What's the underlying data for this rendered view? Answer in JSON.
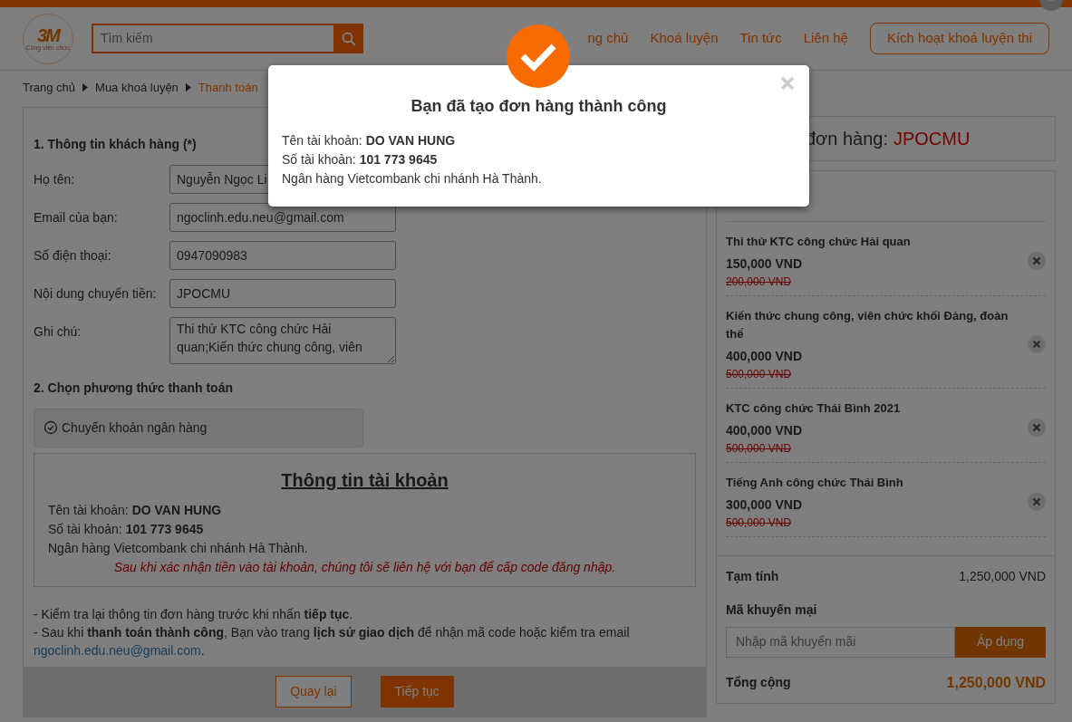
{
  "logo": {
    "text": "3M",
    "tagline": "Công viên chức"
  },
  "search": {
    "placeholder": "Tìm kiếm"
  },
  "nav": [
    {
      "label": "ng chủ"
    },
    {
      "label": "Khoá luyện"
    },
    {
      "label": "Tin tức"
    },
    {
      "label": "Liên hệ"
    }
  ],
  "activate_button": "Kích hoạt khoá luyện thi",
  "breadcrumb": [
    {
      "label": "Trang chủ",
      "current": false
    },
    {
      "label": "Mua khoá luyện",
      "current": false
    },
    {
      "label": "Thanh toán",
      "current": true
    }
  ],
  "customer": {
    "title": "1. Thông tin khách hàng (*)",
    "fields": [
      {
        "label": "Họ tên:",
        "value": "Nguyễn Ngọc Li",
        "kind": "input"
      },
      {
        "label": "Email của bạn:",
        "value": "ngoclinh.edu.neu@gmail.com",
        "kind": "input"
      },
      {
        "label": "Số điện thoại:",
        "value": "0947090983",
        "kind": "input"
      },
      {
        "label": "Nội dung chuyển tiền:",
        "value": "JPOCMU",
        "kind": "input"
      },
      {
        "label": "Ghi chú:",
        "value": "Thi thử KTC công chức Hải quan;Kiến thức chung công, viên",
        "kind": "textarea"
      }
    ]
  },
  "payment": {
    "title": "2. Chọn phương thức thanh toán",
    "methods": [
      {
        "label": "Chuyển khoản ngân hàng",
        "selected": true
      }
    ],
    "account": {
      "title": "Thông tin tài khoản",
      "lines": [
        "Tên tài khoản: **DO VAN HUNG**",
        "Số tài khoản: **101 773 9645**",
        "Ngân hàng Vietcombank chi nhánh Hà Thành."
      ],
      "notice": "Sau khi xác nhận tiền vào tài khoản, chúng tôi sẽ liên hệ với bạn để cấp code đăng nhập."
    }
  },
  "notes": [
    {
      "text": "- Kiểm tra lại thông tin đơn hàng trước khi nhấn **tiếp tục**."
    },
    {
      "text": "- Sau khi **thanh toán thành công**, Bạn vào trang **lịch sử giao dịch** để nhận mã code hoặc kiểm tra email",
      "link": "ngoclinh.edu.neu@gmail.com",
      "tail": "."
    }
  ],
  "buttons": {
    "back": "Quay lại",
    "next": "Tiếp tục"
  },
  "order": {
    "code_label": "đơn hàng:",
    "code": "JPOCMU",
    "items": [
      {
        "name": "Thi thử KTC công chức Hải quan",
        "price": "150,000 VND",
        "old_price": "200,000 VND"
      },
      {
        "name": "Kiến thức chung công, viên chức khối Đảng, đoàn thể",
        "price": "400,000 VND",
        "old_price": "500,000 VND"
      },
      {
        "name": "KTC công chức Thái Bình 2021",
        "price": "400,000 VND",
        "old_price": "500,000 VND"
      },
      {
        "name": "Tiếng Anh công chức Thái Bình",
        "price": "300,000 VND",
        "old_price": "500,000 VND"
      }
    ],
    "subtotal_label": "Tạm tính",
    "subtotal": "1,250,000 VND",
    "promo_label": "Mã khuyến mại",
    "promo_placeholder": "Nhập mã khuyến mãi",
    "promo_button": "Áp dụng",
    "total_label": "Tổng cộng",
    "total": "1,250,000 VND"
  },
  "modal": {
    "title": "Bạn đã tạo đơn hàng thành công",
    "lines": [
      "Tên tài khoản: **DO VAN HUNG**",
      "Số tài khoản: **101 773 9645**",
      "Ngân hàng Vietcombank chi nhánh Hà Thành."
    ]
  }
}
